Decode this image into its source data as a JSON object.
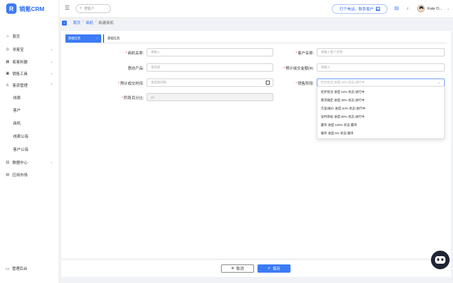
{
  "app": {
    "logo_mark": "R",
    "name": "销氪CRM"
  },
  "sidebar": {
    "items": [
      {
        "label": "首页",
        "icon": "home-icon",
        "glyph": "⌂",
        "chevron": ""
      },
      {
        "label": "寻客宝",
        "icon": "target-icon",
        "glyph": "◎",
        "chevron": "⌄"
      },
      {
        "label": "拓客利器",
        "icon": "grid-icon",
        "glyph": "▦",
        "chevron": "⌄"
      },
      {
        "label": "销售工具",
        "icon": "briefcase-icon",
        "glyph": "▣",
        "chevron": "⌄"
      },
      {
        "label": "客资管理",
        "icon": "user-icon",
        "glyph": "♙",
        "chevron": "⌃"
      }
    ],
    "sub_items": [
      "线索",
      "客户",
      "商机",
      "线索公海",
      "客户公海"
    ],
    "items_bottom": [
      {
        "label": "数据中心",
        "icon": "chart-icon",
        "glyph": "▥",
        "chevron": "⌄"
      },
      {
        "label": "应用市场",
        "icon": "apps-icon",
        "glyph": "▤",
        "chevron": ""
      }
    ],
    "admin_label": "管理后台"
  },
  "header": {
    "collapse_glyph": "☰",
    "search_placeholder": "搜客户",
    "call_label": "打个电话，联系客户",
    "user_name": "Kate D...",
    "chevron": "⌄"
  },
  "breadcrumb": {
    "home": "首页",
    "parent": "商机",
    "current": "新建商机"
  },
  "form": {
    "tab_active": "基础信息",
    "tab_label": "基础信息",
    "name_label": "商机名称:",
    "name_placeholder": "请输入",
    "customer_label": "客户名称:",
    "customer_placeholder": "请输入客户名称",
    "product_label": "意向产品:",
    "product_placeholder": "请选择",
    "amount_label": "预计成交金额(¥):",
    "amount_placeholder": "请输入",
    "date_label": "预计成交时间:",
    "date_placeholder": "请选择日期",
    "stage_label": "销售阶段:",
    "stage_placeholder": "初步接洽 进度:10% 状态:进行中",
    "percent_label": "阶段百分比:",
    "percent_value": "10"
  },
  "stage_options": [
    "初步接洽 进度:10% 状态:进行中",
    "需求确定 进度:30% 状态:进行中",
    "方案/报价 进度:40% 状态:进行中",
    "谈判审核 进度:80% 状态:进行中",
    "赢单 进度:100% 状态:赢单",
    "输单 进度:0% 状态:输单"
  ],
  "footer": {
    "cancel_label": "取消",
    "save_label": "保存"
  },
  "colors": {
    "primary": "#3c7bf6",
    "required": "#f04a4a"
  }
}
